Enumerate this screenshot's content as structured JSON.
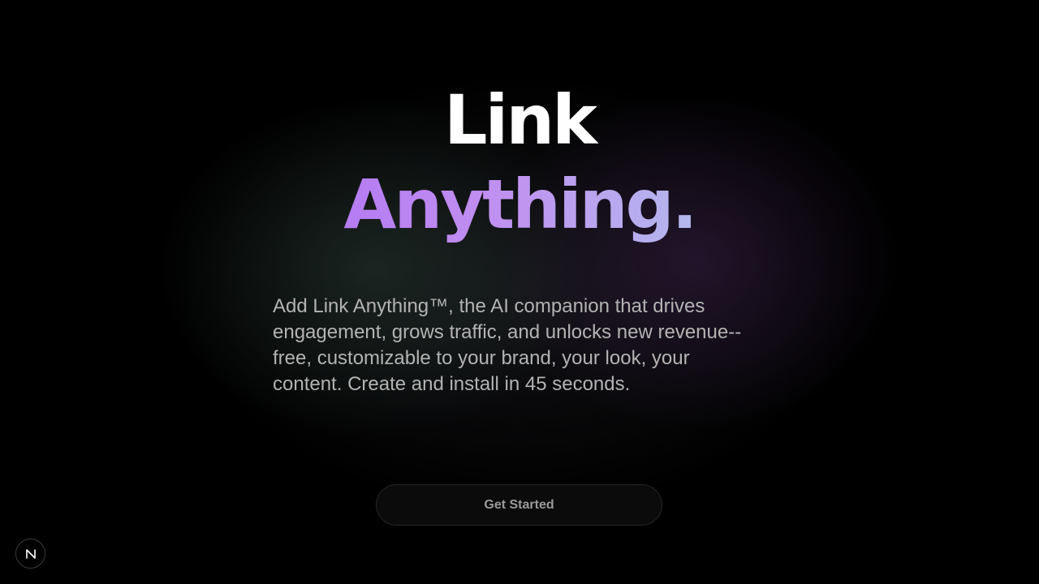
{
  "hero": {
    "title_line_1": "Link",
    "title_line_2": "Anything.",
    "description": "Add Link Anything™, the AI companion that drives engagement, grows traffic, and unlocks new revenue-- free, customizable to your brand, your look, your content. Create and install in 45 seconds."
  },
  "cta": {
    "label": "Get Started"
  },
  "badge": {
    "icon": "next-logo-icon"
  },
  "colors": {
    "background": "#000000",
    "title_white": "#ffffff",
    "gradient_start": "#b57cf2",
    "gradient_end": "#b3b8ee",
    "description_text": "#b3b3b3",
    "button_text": "#9a9a9a"
  }
}
